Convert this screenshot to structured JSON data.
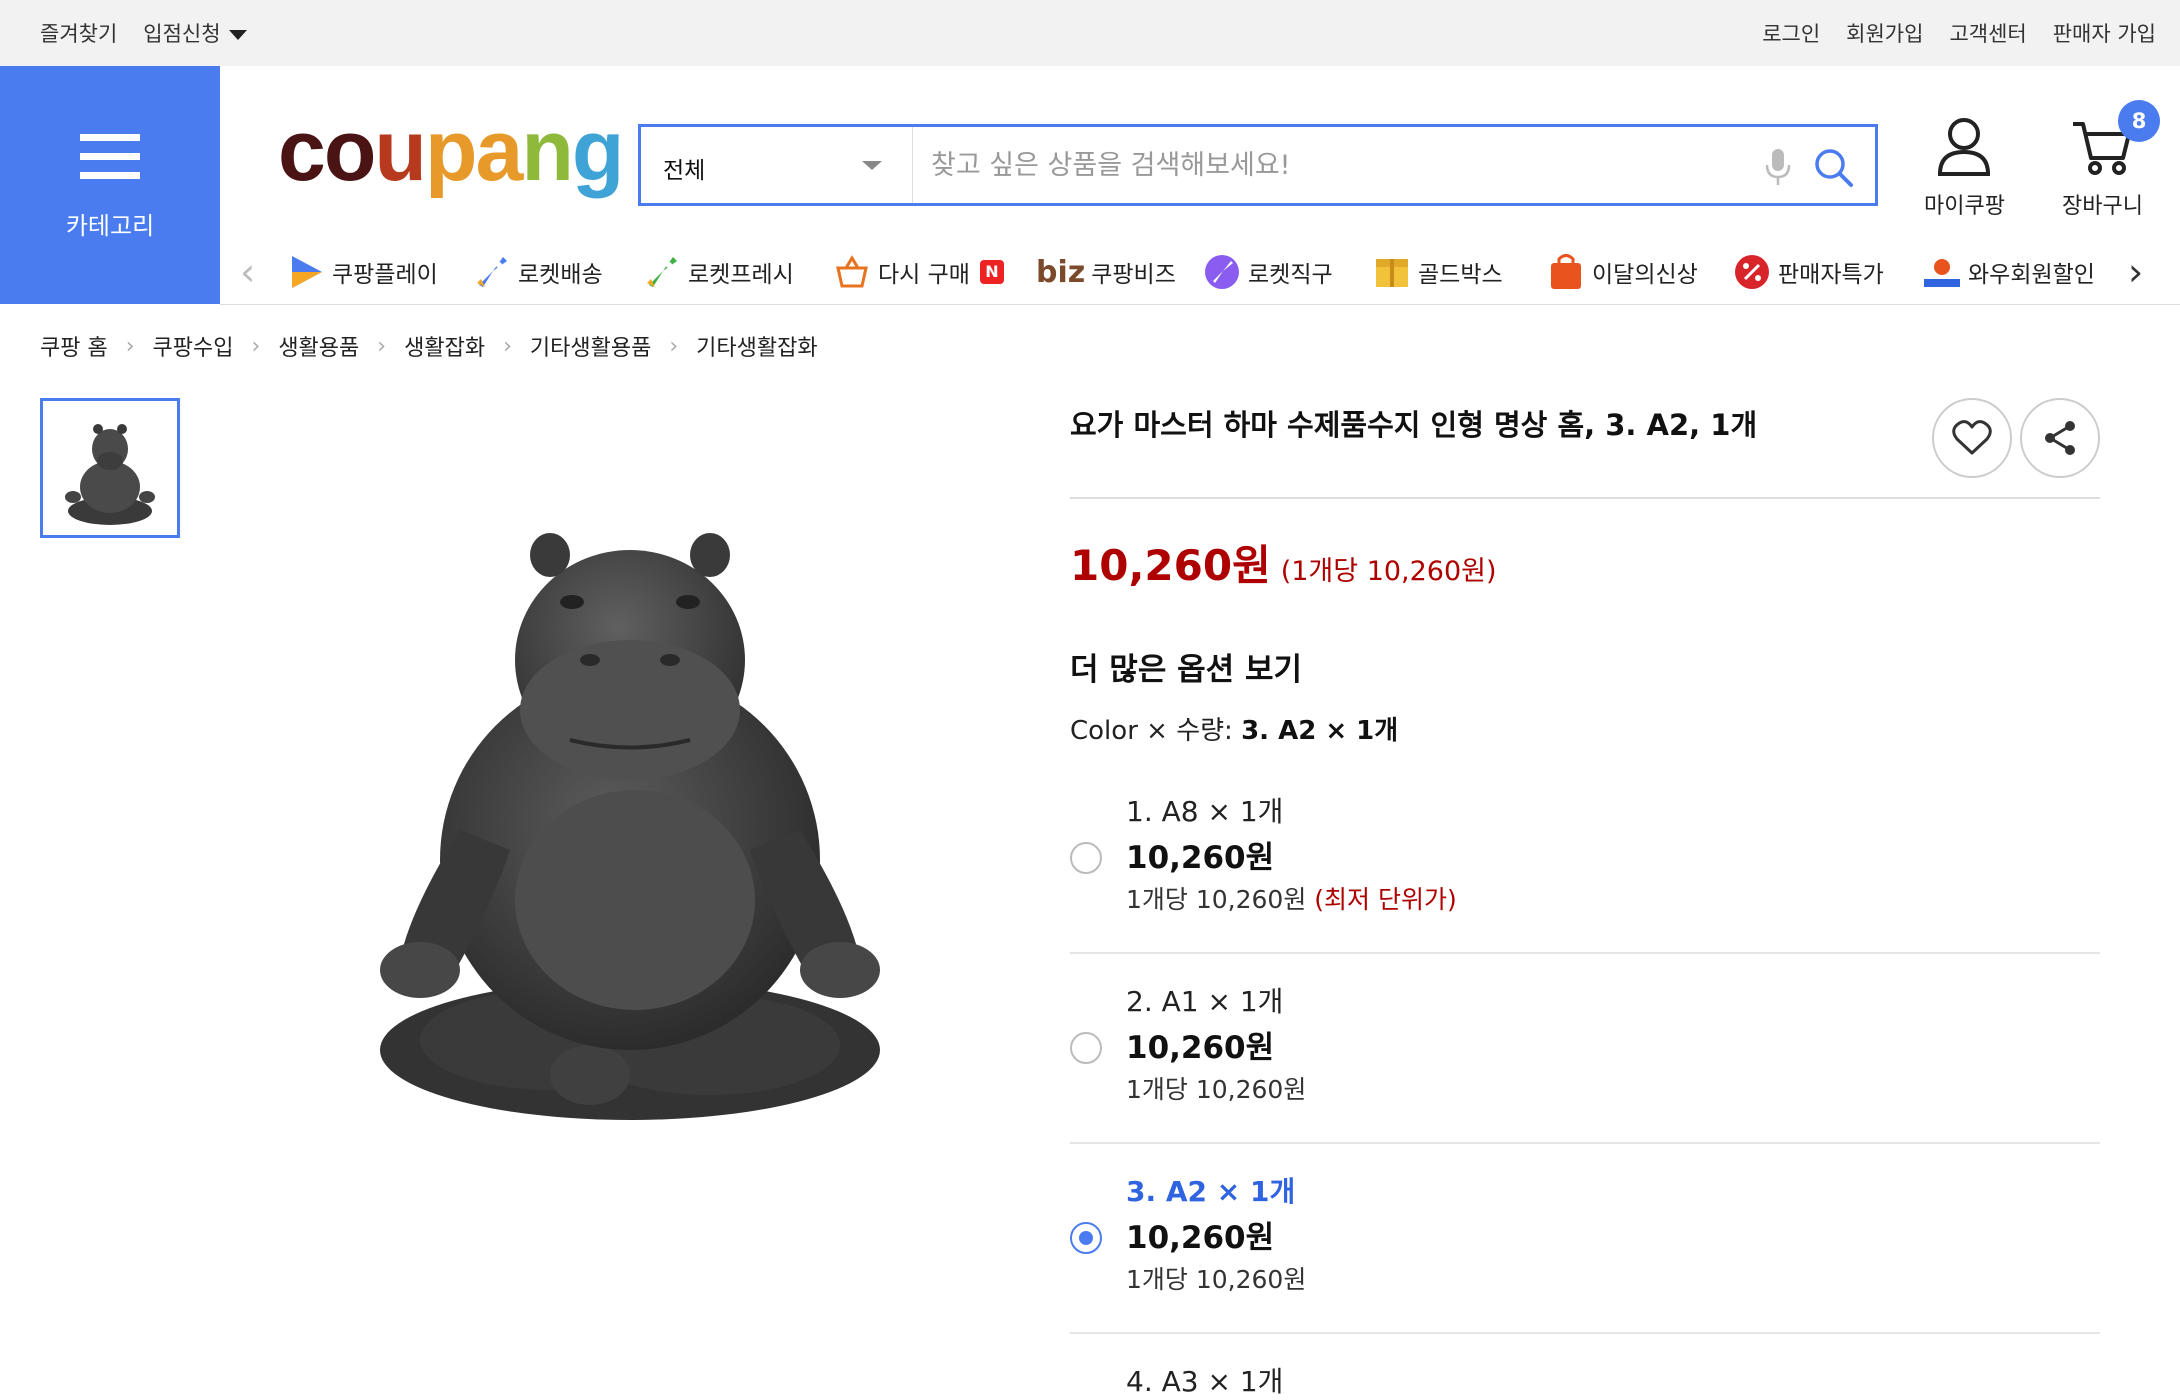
{
  "topbar": {
    "bookmark": "즐겨찾기",
    "partner": "입점신청",
    "login": "로그인",
    "signup": "회원가입",
    "support": "고객센터",
    "seller_signup": "판매자 가입"
  },
  "category": {
    "label": "카테고리"
  },
  "logo": {
    "c": "c",
    "o": "o",
    "u": "u",
    "p": "p",
    "a": "a",
    "n": "n",
    "g": "g"
  },
  "search": {
    "category": "전체",
    "placeholder": "찾고 싶은 상품을 검색해보세요!"
  },
  "header": {
    "mycoupang": "마이쿠팡",
    "cart": "장바구니",
    "cart_count": "8"
  },
  "nav": [
    {
      "label": "쿠팡플레이"
    },
    {
      "label": "로켓배송"
    },
    {
      "label": "로켓프레시"
    },
    {
      "label": "다시 구매",
      "badge": "N"
    },
    {
      "label": "쿠팡비즈",
      "prefix": "biz"
    },
    {
      "label": "로켓직구"
    },
    {
      "label": "골드박스"
    },
    {
      "label": "이달의신상"
    },
    {
      "label": "판매자특가"
    },
    {
      "label": "와우회원할인"
    }
  ],
  "breadcrumb": [
    "쿠팡 홈",
    "쿠팡수입",
    "생활용품",
    "생활잡화",
    "기타생활용품",
    "기타생활잡화"
  ],
  "product": {
    "title": "요가 마스터 하마 수제품수지 인형 명상 홈, 3. A2, 1개",
    "price": "10,260원",
    "unit_price": "(1개당 10,260원)"
  },
  "options": {
    "heading": "더 많은 옵션 보기",
    "selected_label": "Color × 수량:",
    "selected_value": "3. A2 × 1개",
    "items": [
      {
        "name": "1. A8 × 1개",
        "price": "10,260원",
        "per": "1개당 10,260원",
        "lowest": "(최저 단위가)",
        "selected": false
      },
      {
        "name": "2. A1 × 1개",
        "price": "10,260원",
        "per": "1개당 10,260원",
        "lowest": "",
        "selected": false
      },
      {
        "name": "3. A2 × 1개",
        "price": "10,260원",
        "per": "1개당 10,260원",
        "lowest": "",
        "selected": true
      },
      {
        "name": "4. A3 × 1개",
        "price": "",
        "per": "",
        "lowest": "",
        "selected": false
      }
    ]
  },
  "colors": {
    "brand_blue": "#4a7cf0",
    "price_red": "#ae0000"
  }
}
